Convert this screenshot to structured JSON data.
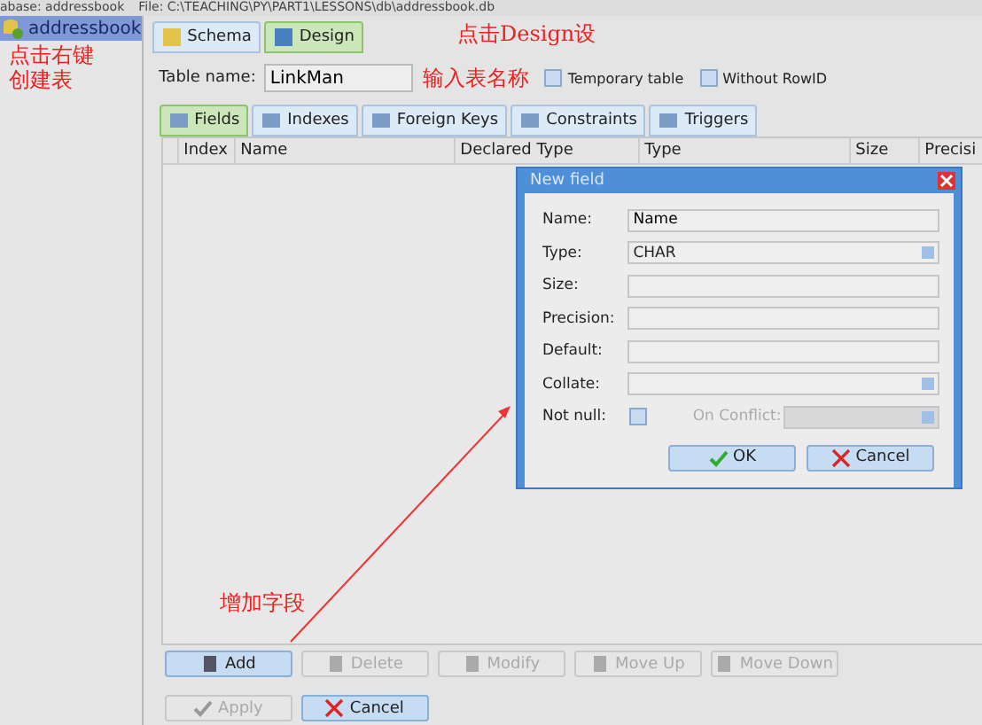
{
  "title_bar": {
    "database": "abase: addressbook",
    "file": "File: C:\\TEACHING\\PY\\PART1\\LESSONS\\db\\addressbook.db"
  },
  "sidebar": {
    "items": [
      {
        "label": "addressbook",
        "selected": true
      }
    ]
  },
  "main_tabs": [
    {
      "label": "Schema",
      "selected": false
    },
    {
      "label": "Design",
      "selected": true
    }
  ],
  "table_name": {
    "label": "Table name:",
    "value": "LinkMan"
  },
  "options": [
    {
      "label": "Temporary table",
      "checked": false
    },
    {
      "label": "Without RowID",
      "checked": false
    }
  ],
  "sub_tabs": [
    {
      "label": "Fields",
      "selected": true
    },
    {
      "label": "Indexes",
      "selected": false
    },
    {
      "label": "Foreign Keys",
      "selected": false
    },
    {
      "label": "Constraints",
      "selected": false
    },
    {
      "label": "Triggers",
      "selected": false
    }
  ],
  "columns": [
    "Index",
    "Name",
    "Declared Type",
    "Type",
    "Size",
    "Precisi"
  ],
  "field_buttons": [
    {
      "label": "Add",
      "disabled": false
    },
    {
      "label": "Delete",
      "disabled": true
    },
    {
      "label": "Modify",
      "disabled": true
    },
    {
      "label": "Move Up",
      "disabled": true
    },
    {
      "label": "Move Down",
      "disabled": true
    }
  ],
  "bottom_buttons": [
    {
      "label": "Apply",
      "disabled": true
    },
    {
      "label": "Cancel",
      "disabled": false
    }
  ],
  "dialog": {
    "title": "New field",
    "rows": [
      {
        "kind": "text",
        "label": "Name:",
        "value": "Name"
      },
      {
        "kind": "combo",
        "label": "Type:",
        "value": "CHAR"
      },
      {
        "kind": "text",
        "label": "Size:",
        "value": ""
      },
      {
        "kind": "text",
        "label": "Precision:",
        "value": ""
      },
      {
        "kind": "text",
        "label": "Default:",
        "value": ""
      },
      {
        "kind": "combo",
        "label": "Collate:",
        "value": ""
      }
    ],
    "not_null": {
      "label": "Not null:",
      "checked": false
    },
    "on_conflict": {
      "label": "On Conflict:",
      "disabled": true
    },
    "buttons": [
      "OK",
      "Cancel"
    ]
  },
  "annotations": {
    "sidebar": [
      "点击右键",
      "创建表"
    ],
    "design": "点击Design设",
    "table_name": "输入表名称",
    "add": "增加字段"
  }
}
